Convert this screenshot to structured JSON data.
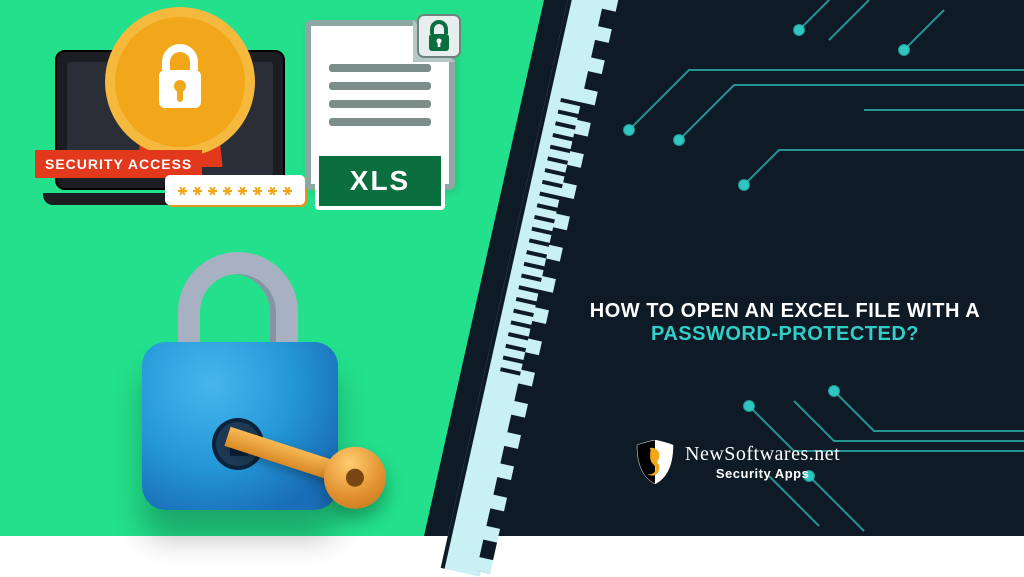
{
  "banner": {
    "title_line1": "HOW TO OPEN AN EXCEL FILE WITH A",
    "title_line2": "PASSWORD-PROTECTED?",
    "security_tag": "SECURITY ACCESS",
    "file_label": "XLS",
    "password_mask": "********",
    "accent_color": "#32cfc9",
    "bg_left": "#23e08c",
    "bg_right": "#0e1a26"
  },
  "brand": {
    "name": "NewSoftwares.net",
    "tagline": "Security Apps"
  }
}
